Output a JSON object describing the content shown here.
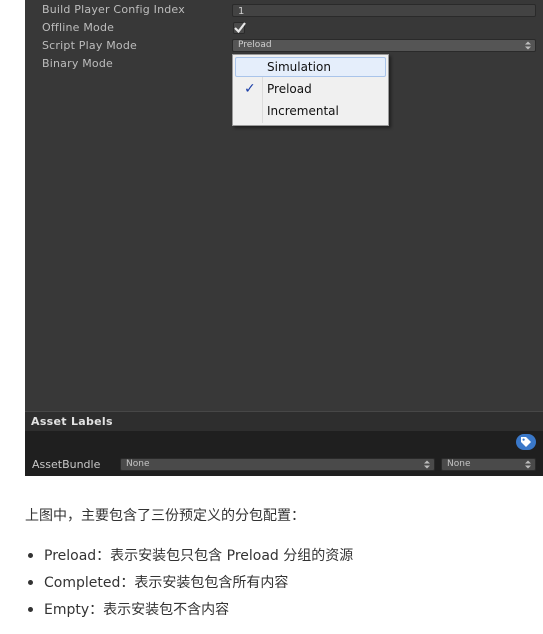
{
  "inspector": {
    "build_player_config_index_label": "Build Player Config Index",
    "build_player_config_index_value": "1",
    "offline_mode_label": "Offline Mode",
    "offline_mode_checked": true,
    "script_play_mode_label": "Script Play Mode",
    "script_play_mode_value": "Preload",
    "binary_mode_label": "Binary Mode"
  },
  "dropdown": {
    "options": [
      "Simulation",
      "Preload",
      "Incremental"
    ],
    "selected": "Preload",
    "highlighted": "Simulation",
    "check_glyph": "✓"
  },
  "asset_labels": {
    "header": "Asset Labels",
    "assetbundle_label": "AssetBundle",
    "assetbundle_name": "None",
    "assetbundle_variant": "None"
  },
  "article": {
    "intro": "上图中，主要包含了三份预定义的分包配置：",
    "bullets": [
      "Preload：表示安装包只包含 Preload 分组的资源",
      "Completed：表示安装包包含所有内容",
      "Empty：表示安装包不含内容"
    ]
  },
  "colors": {
    "panel_bg": "#383838",
    "popup_bg": "#f0f0f0",
    "highlight": "#e5eefb",
    "tag_button": "#3a78c9"
  }
}
